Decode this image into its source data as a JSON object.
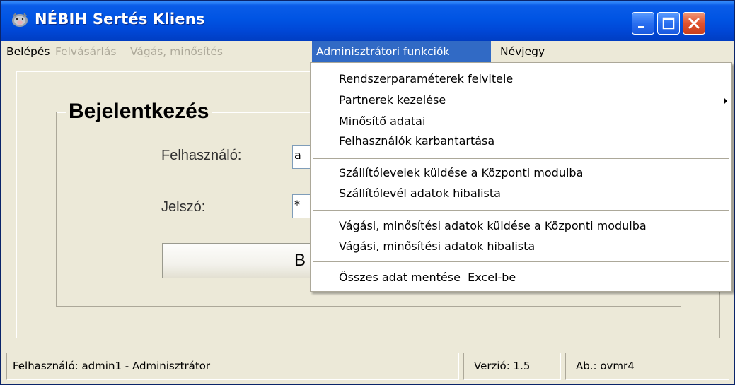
{
  "window": {
    "title": "NÉBIH Sertés Kliens",
    "icon": "pig-icon"
  },
  "menubar": {
    "items": [
      {
        "label": "Belépés",
        "state": "enabled"
      },
      {
        "label": "Felvásárlás",
        "state": "disabled"
      },
      {
        "label": "Vágás, minősítés",
        "state": "disabled"
      },
      {
        "label": "Adminisztrátori funkciók",
        "state": "active"
      },
      {
        "label": "Névjegy",
        "state": "enabled"
      }
    ]
  },
  "dropdown": {
    "items": [
      {
        "label": "Rendszerparaméterek felvitele",
        "submenu": false
      },
      {
        "label": "Partnerek kezelése",
        "submenu": true
      },
      {
        "label": "Minősítő adatai",
        "submenu": false
      },
      {
        "label": "Felhasználók karbantartása",
        "submenu": false
      },
      {
        "label": "Szállítólevelek küldése a Központi modulba",
        "submenu": false
      },
      {
        "label": "Szállítólevél adatok hibalista",
        "submenu": false
      },
      {
        "label": "Vágási, minősítési adatok küldése a Központi modulba",
        "submenu": false
      },
      {
        "label": "Vágási, minősítési adatok hibalista",
        "submenu": false
      },
      {
        "label": "Összes adat mentése  Excel-be",
        "submenu": false
      }
    ]
  },
  "login": {
    "group_title": "Bejelentkezés",
    "user_label": "Felhasználó:",
    "user_value": "a",
    "password_label": "Jelszó:",
    "password_value": "*",
    "button_label": "B"
  },
  "statusbar": {
    "user": "Felhasználó: admin1 - Adminisztrátor",
    "version": "Verzió: 1.5",
    "database": "Ab.: ovmr4"
  },
  "colors": {
    "titlebar": "#0054e3",
    "menu_highlight": "#316ac5",
    "window_bg": "#ece9d8",
    "close_button": "#e0522e"
  }
}
